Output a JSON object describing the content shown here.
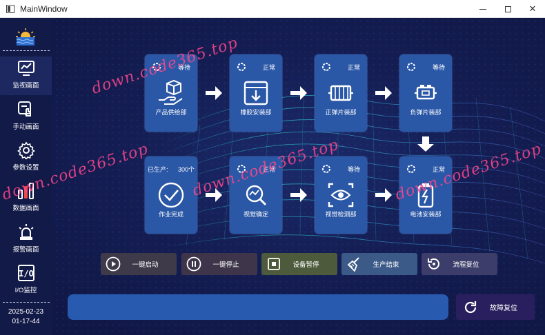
{
  "window": {
    "title": "MainWindow"
  },
  "sidebar": {
    "items": [
      {
        "label": "监视画面",
        "icon": "monitor-chart-icon"
      },
      {
        "label": "手动画面",
        "icon": "manual-touch-icon"
      },
      {
        "label": "参数设置",
        "icon": "gear-icon"
      },
      {
        "label": "数据画面",
        "icon": "bar-chart-icon"
      },
      {
        "label": "报警画面",
        "icon": "alarm-light-icon"
      },
      {
        "label": "I/O监控",
        "icon": "io-icon"
      }
    ],
    "active_index": 0,
    "date": "2025-02-23",
    "time": "01-17-44"
  },
  "stations": [
    {
      "name": "产品供给部",
      "status": "等待",
      "icon": "package-hand-icon"
    },
    {
      "name": "橡胶安装部",
      "status": "正常",
      "icon": "box-down-icon"
    },
    {
      "name": "正弹片装部",
      "status": "正常",
      "icon": "spring-icon"
    },
    {
      "name": "负弹片装部",
      "status": "等待",
      "icon": "battery-part-icon"
    },
    {
      "name": "作业完成",
      "produced_label": "已生产:",
      "produced_value": "300个",
      "icon": "check-circle-icon"
    },
    {
      "name": "视觉确定",
      "status": "正常",
      "icon": "vision-search-icon"
    },
    {
      "name": "视觉检测部",
      "status": "等待",
      "icon": "eye-scan-icon"
    },
    {
      "name": "电池安装部",
      "status": "正常",
      "icon": "battery-bolt-icon"
    }
  ],
  "controls": [
    {
      "label": "一键启动",
      "icon": "play-icon",
      "color": "#3f3a4a"
    },
    {
      "label": "一键停止",
      "icon": "pause-icon",
      "color": "#3e354a"
    },
    {
      "label": "设备暂停",
      "icon": "stop-icon",
      "color": "#4d5a3b"
    },
    {
      "label": "生产结束",
      "icon": "broom-icon",
      "color": "#3c5a88"
    },
    {
      "label": "流程复位",
      "icon": "reset-icon",
      "color": "#3c3d6a"
    }
  ],
  "fault_reset": {
    "label": "故障复位",
    "icon": "refresh-icon"
  },
  "watermark": "down.code365.top"
}
